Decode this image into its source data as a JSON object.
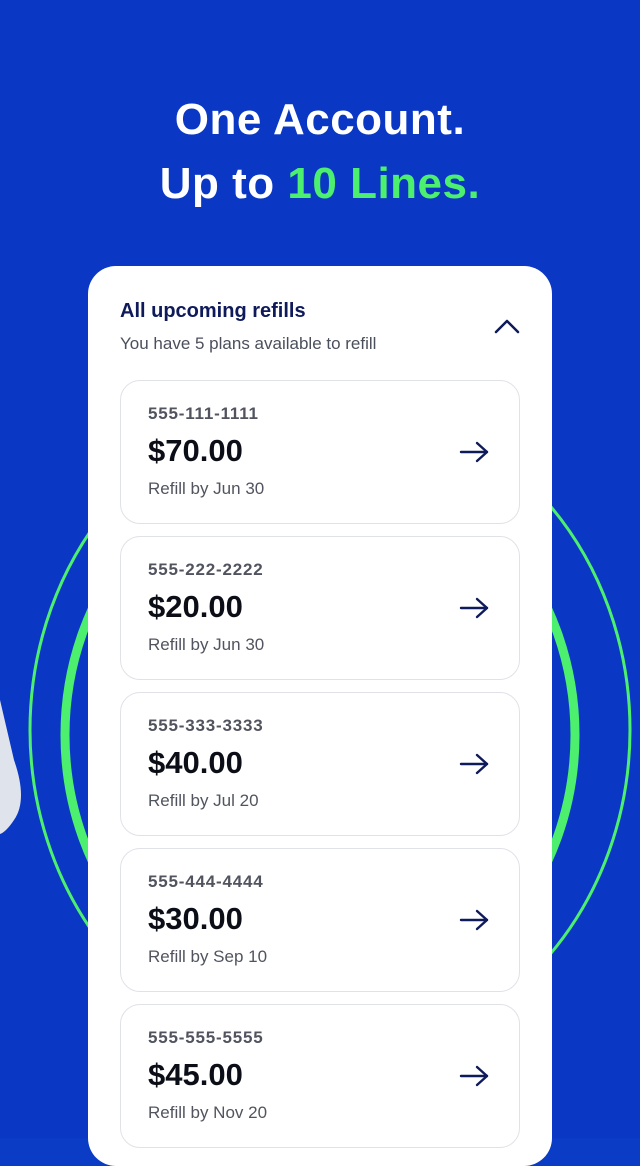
{
  "headline": {
    "line1": "One Account.",
    "line2_prefix": "Up to ",
    "line2_accent": "10 Lines."
  },
  "colors": {
    "background": "#0a38c4",
    "accent": "#4cf06e",
    "card": "#ffffff",
    "title": "#0e1a5a"
  },
  "card": {
    "title": "All upcoming refills",
    "subtitle": "You have 5 plans available to refill",
    "collapse_icon": "chevron-up-icon"
  },
  "refills": [
    {
      "phone": "555-111-1111",
      "amount": "$70.00",
      "due": "Refill by Jun 30",
      "icon": "arrow-right-icon"
    },
    {
      "phone": "555-222-2222",
      "amount": "$20.00",
      "due": "Refill by Jun 30",
      "icon": "arrow-right-icon"
    },
    {
      "phone": "555-333-3333",
      "amount": "$40.00",
      "due": "Refill by Jul 20",
      "icon": "arrow-right-icon"
    },
    {
      "phone": "555-444-4444",
      "amount": "$30.00",
      "due": "Refill by Sep 10",
      "icon": "arrow-right-icon"
    },
    {
      "phone": "555-555-5555",
      "amount": "$45.00",
      "due": "Refill by Nov 20",
      "icon": "arrow-right-icon"
    }
  ]
}
